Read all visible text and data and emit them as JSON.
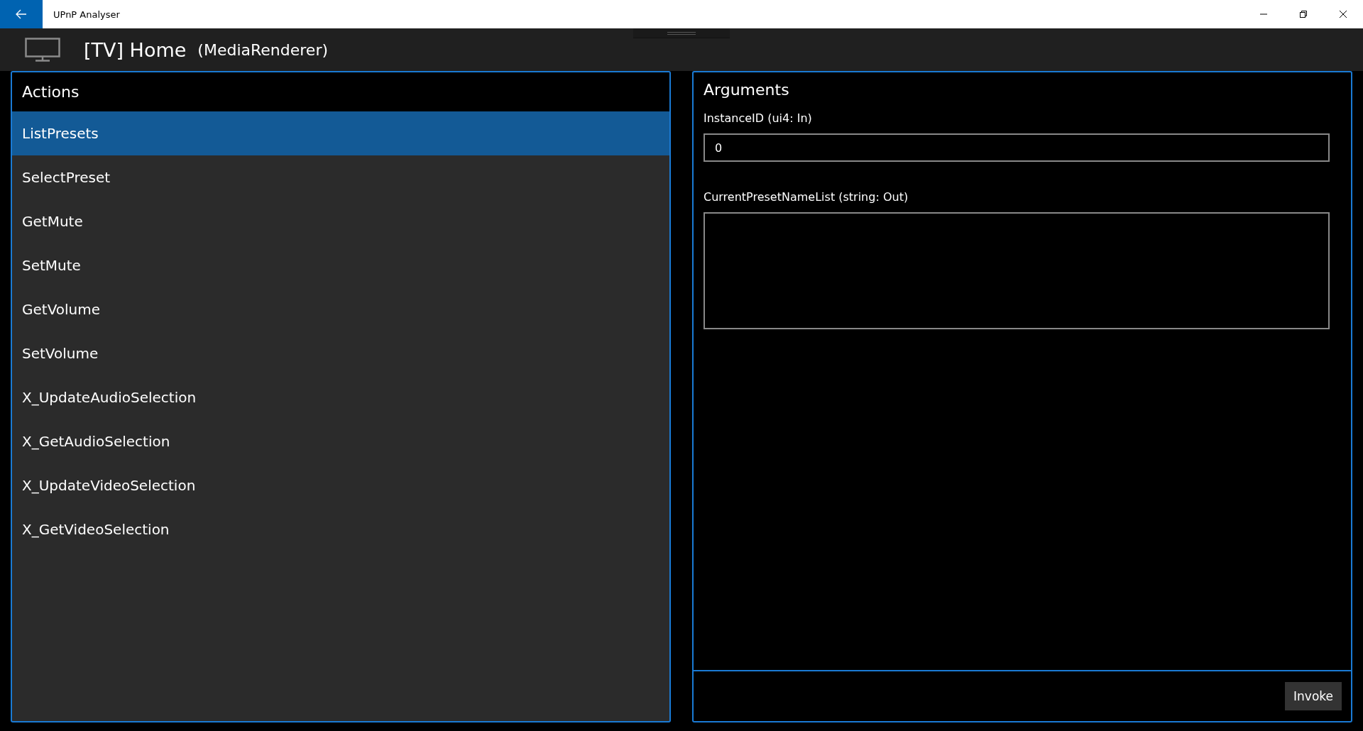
{
  "window": {
    "title": "UPnP Analyser"
  },
  "header": {
    "device_name": "[TV] Home",
    "device_type": "(MediaRenderer)"
  },
  "actions": {
    "title": "Actions",
    "items": [
      {
        "label": "ListPresets",
        "selected": true
      },
      {
        "label": "SelectPreset",
        "selected": false
      },
      {
        "label": "GetMute",
        "selected": false
      },
      {
        "label": "SetMute",
        "selected": false
      },
      {
        "label": "GetVolume",
        "selected": false
      },
      {
        "label": "SetVolume",
        "selected": false
      },
      {
        "label": "X_UpdateAudioSelection",
        "selected": false
      },
      {
        "label": "X_GetAudioSelection",
        "selected": false
      },
      {
        "label": "X_UpdateVideoSelection",
        "selected": false
      },
      {
        "label": "X_GetVideoSelection",
        "selected": false
      }
    ]
  },
  "arguments": {
    "title": "Arguments",
    "fields": [
      {
        "label": "InstanceID (ui4: In)",
        "kind": "input",
        "value": "0"
      },
      {
        "label": "CurrentPresetNameList (string: Out)",
        "kind": "output"
      }
    ]
  },
  "invoke_button": "Invoke"
}
